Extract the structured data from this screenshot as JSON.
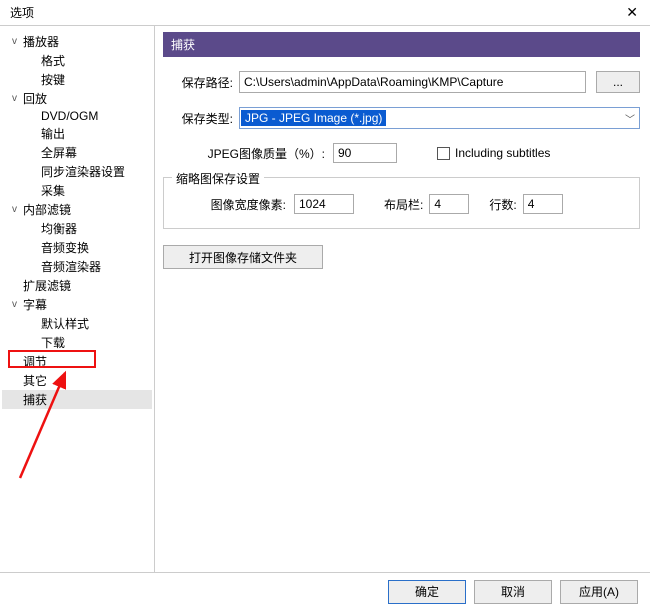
{
  "window": {
    "title": "选项",
    "close": "✕"
  },
  "tree": {
    "items": [
      {
        "label": "播放器",
        "level": 0,
        "exp": "v"
      },
      {
        "label": "格式",
        "level": 1
      },
      {
        "label": "按键",
        "level": 1
      },
      {
        "label": "回放",
        "level": 0,
        "exp": "v"
      },
      {
        "label": "DVD/OGM",
        "level": 1
      },
      {
        "label": "输出",
        "level": 1
      },
      {
        "label": "全屏幕",
        "level": 1
      },
      {
        "label": "同步渲染器设置",
        "level": 1
      },
      {
        "label": "采集",
        "level": 1
      },
      {
        "label": "内部滤镜",
        "level": 0,
        "exp": "v"
      },
      {
        "label": "均衡器",
        "level": 1
      },
      {
        "label": "音频变换",
        "level": 1
      },
      {
        "label": "音频渲染器",
        "level": 1
      },
      {
        "label": "扩展滤镜",
        "level": 0
      },
      {
        "label": "字幕",
        "level": 0,
        "exp": "v"
      },
      {
        "label": "默认样式",
        "level": 1
      },
      {
        "label": "下载",
        "level": 1
      },
      {
        "label": "调节",
        "level": 0
      },
      {
        "label": "其它",
        "level": 0
      },
      {
        "label": "捕获",
        "level": 0,
        "selected": true
      }
    ]
  },
  "panel": {
    "title": "捕获",
    "save_path_label": "保存路径:",
    "save_path_value": "C:\\Users\\admin\\AppData\\Roaming\\KMP\\Capture",
    "browse": "...",
    "save_type_label": "保存类型:",
    "save_type_value": "JPG - JPEG Image (*.jpg)",
    "jpeg_quality_label": "JPEG图像质量（%）:",
    "jpeg_quality_value": "90",
    "include_sub_label": "Including subtitles",
    "thumb_fieldset": {
      "legend": "缩略图保存设置",
      "width_label": "图像宽度像素:",
      "width_value": "1024",
      "cols_label": "布局栏:",
      "cols_value": "4",
      "rows_label": "行数:",
      "rows_value": "4"
    },
    "open_folder": "打开图像存储文件夹"
  },
  "footer": {
    "ok": "确定",
    "cancel": "取消",
    "apply": "应用(A)"
  }
}
